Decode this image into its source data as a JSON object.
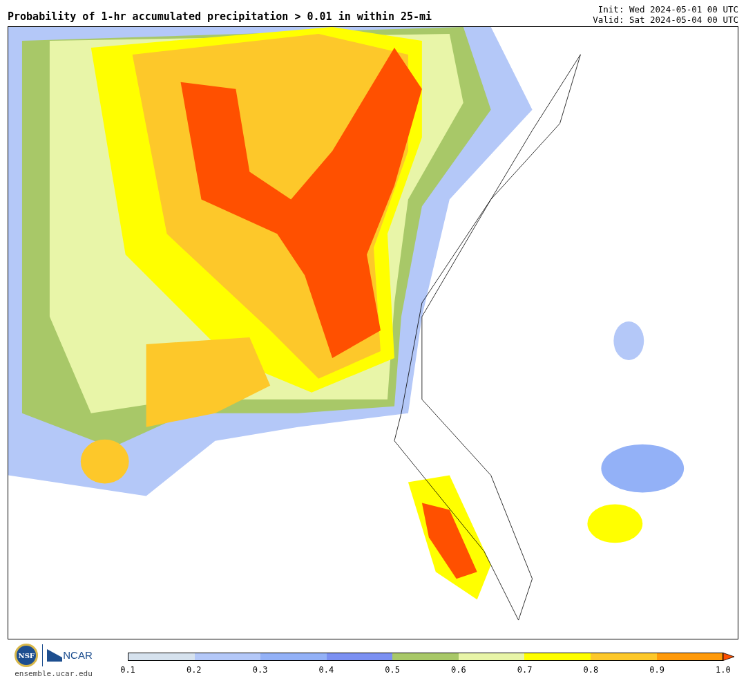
{
  "title": "Probability of 1-hr accumulated precipitation > 0.01 in within 25-mi",
  "init": "Init: Wed 2024-05-01 00 UTC",
  "valid": "Valid: Sat 2024-05-04 00 UTC",
  "logos": {
    "nsf": "NSF",
    "ncar": "NCAR",
    "url": "ensemble.ucar.edu"
  },
  "colorbar": {
    "segments": [
      {
        "color": "#d6e2ee"
      },
      {
        "color": "#b4c8f8"
      },
      {
        "color": "#93b1f7"
      },
      {
        "color": "#7b90f2"
      },
      {
        "color": "#a8c868"
      },
      {
        "color": "#e8f5a8"
      },
      {
        "color": "#ffff00"
      },
      {
        "color": "#fdc82a"
      },
      {
        "color": "#ff9a0a"
      }
    ],
    "extend": {
      "color": "#ff5000"
    },
    "labels": [
      "0.1",
      "0.2",
      "0.3",
      "0.4",
      "0.5",
      "0.6",
      "0.7",
      "0.8",
      "0.9",
      "1.0"
    ]
  }
}
